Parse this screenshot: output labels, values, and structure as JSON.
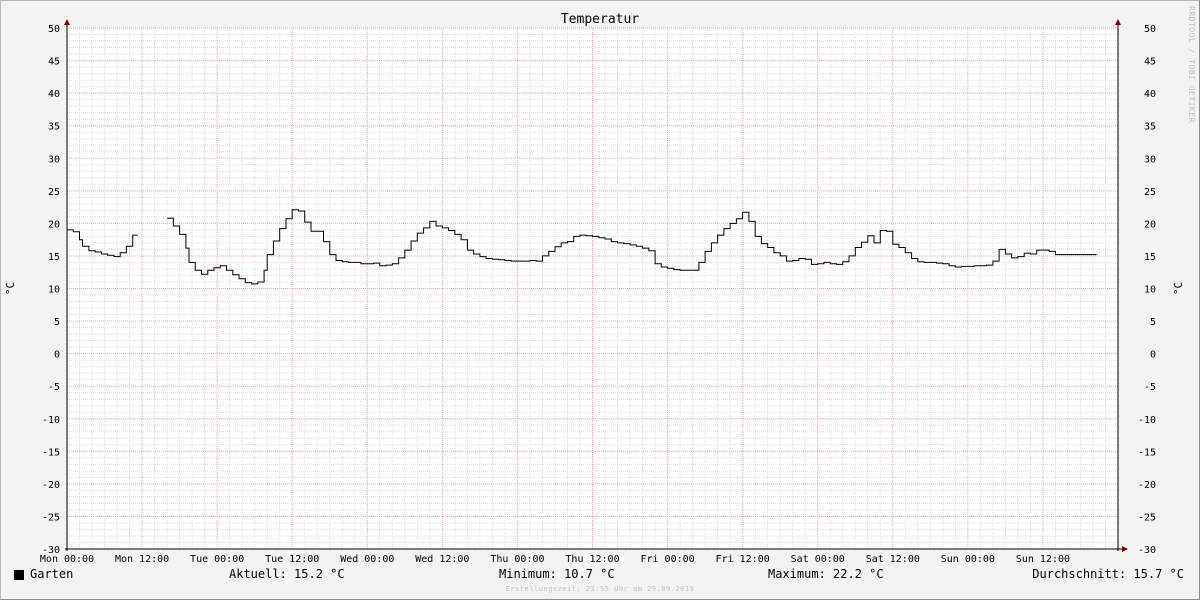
{
  "colors": {
    "background": "#f3f3f3",
    "canvas": "#ffffff",
    "minor_grid": "#dcdcdc",
    "major_grid": "#e8a6a6",
    "line": "#000000",
    "axis_arrow": "#7a0000"
  },
  "watermark": "RRDTOOL / TOBI OETIKER",
  "legend": {
    "series_name": "Garten",
    "current": "Aktuell: 15.2 °C",
    "minimum": "Minimum: 10.7 °C",
    "maximum": "Maximum: 22.2 °C",
    "average": "Durchschnitt: 15.7 °C"
  },
  "footer": "Erstellungszeit: 23:55 Uhr am 29.09.2019",
  "chart_data": {
    "type": "line",
    "title": "Temperatur",
    "ylabel": "°C",
    "ylabel_right": "°C",
    "ylim": [
      -30,
      50
    ],
    "xlim_hours": [
      0,
      168
    ],
    "y_ticks": [
      50,
      45,
      40,
      35,
      30,
      25,
      20,
      15,
      10,
      5,
      0,
      -5,
      -10,
      -15,
      -20,
      -25,
      -30
    ],
    "x_ticks": [
      {
        "hour": 0,
        "label": "Mon 00:00"
      },
      {
        "hour": 12,
        "label": "Mon 12:00"
      },
      {
        "hour": 24,
        "label": "Tue 00:00"
      },
      {
        "hour": 36,
        "label": "Tue 12:00"
      },
      {
        "hour": 48,
        "label": "Wed 00:00"
      },
      {
        "hour": 60,
        "label": "Wed 12:00"
      },
      {
        "hour": 72,
        "label": "Thu 00:00"
      },
      {
        "hour": 84,
        "label": "Thu 12:00"
      },
      {
        "hour": 96,
        "label": "Fri 00:00"
      },
      {
        "hour": 108,
        "label": "Fri 12:00"
      },
      {
        "hour": 120,
        "label": "Sat 00:00"
      },
      {
        "hour": 132,
        "label": "Sat 12:00"
      },
      {
        "hour": 144,
        "label": "Sun 00:00"
      },
      {
        "hour": 156,
        "label": "Sun 12:00"
      }
    ],
    "grid": true,
    "series": [
      {
        "name": "Garten",
        "step": true,
        "segments": [
          [
            [
              0,
              19
            ],
            [
              1,
              18.7
            ],
            [
              2,
              17.5
            ],
            [
              2.5,
              16.5
            ],
            [
              3.5,
              15.8
            ],
            [
              4.5,
              15.6
            ],
            [
              5.5,
              15.3
            ],
            [
              6.5,
              15.1
            ],
            [
              7.5,
              14.9
            ],
            [
              8.5,
              15.5
            ],
            [
              9.5,
              16.5
            ],
            [
              10.5,
              18.2
            ]
          ],
          [
            [
              16,
              20.8
            ],
            [
              17,
              19.6
            ],
            [
              18,
              18.3
            ],
            [
              19,
              16.2
            ],
            [
              19.5,
              14
            ],
            [
              20.5,
              12.8
            ],
            [
              21.5,
              12.2
            ],
            [
              22.5,
              12.8
            ],
            [
              23.5,
              13.2
            ],
            [
              24.5,
              13.5
            ],
            [
              25.5,
              12.8
            ],
            [
              26.5,
              12.1
            ],
            [
              27.5,
              11.5
            ],
            [
              28.5,
              10.9
            ],
            [
              29.5,
              10.7
            ],
            [
              30.5,
              11
            ],
            [
              31.5,
              12.8
            ],
            [
              32,
              15.2
            ],
            [
              33,
              17.3
            ],
            [
              34,
              19.2
            ],
            [
              35,
              20.7
            ],
            [
              36,
              22.1
            ],
            [
              37,
              21.9
            ],
            [
              38,
              20.2
            ],
            [
              39,
              18.8
            ],
            [
              40,
              18.8
            ],
            [
              41,
              17.2
            ],
            [
              42,
              15.2
            ],
            [
              43,
              14.3
            ],
            [
              44,
              14.1
            ],
            [
              45,
              14
            ],
            [
              46,
              14
            ],
            [
              47,
              13.8
            ],
            [
              48,
              13.8
            ],
            [
              49,
              13.9
            ],
            [
              50,
              13.5
            ],
            [
              51,
              13.6
            ],
            [
              52,
              13.8
            ],
            [
              53,
              14.7
            ],
            [
              54,
              15.9
            ],
            [
              55,
              17.3
            ],
            [
              56,
              18.5
            ],
            [
              57,
              19.3
            ],
            [
              58,
              20.3
            ],
            [
              59,
              19.6
            ],
            [
              60,
              19.3
            ],
            [
              61,
              18.9
            ],
            [
              62,
              18.3
            ],
            [
              63,
              17.5
            ],
            [
              64,
              15.9
            ],
            [
              65,
              15.3
            ],
            [
              66,
              14.9
            ],
            [
              67,
              14.6
            ],
            [
              68,
              14.5
            ],
            [
              69,
              14.4
            ],
            [
              70,
              14.3
            ],
            [
              71,
              14.2
            ],
            [
              72,
              14.2
            ],
            [
              73,
              14.2
            ],
            [
              74,
              14.3
            ],
            [
              75,
              14.2
            ],
            [
              76,
              15
            ],
            [
              77,
              15.7
            ],
            [
              78,
              16.4
            ],
            [
              79,
              17
            ],
            [
              80,
              17.2
            ],
            [
              81,
              18
            ],
            [
              82,
              18.2
            ],
            [
              83,
              18.1
            ],
            [
              84,
              18
            ],
            [
              85,
              17.8
            ],
            [
              86,
              17.6
            ],
            [
              87,
              17.2
            ],
            [
              88,
              17
            ],
            [
              89,
              16.9
            ],
            [
              90,
              16.7
            ],
            [
              91,
              16.5
            ],
            [
              92,
              16.2
            ],
            [
              93,
              15.8
            ],
            [
              94,
              13.8
            ],
            [
              95,
              13.3
            ],
            [
              96,
              13.1
            ],
            [
              97,
              12.9
            ],
            [
              98,
              12.8
            ],
            [
              99,
              12.8
            ],
            [
              100,
              12.8
            ],
            [
              101,
              14
            ],
            [
              102,
              15.7
            ],
            [
              103,
              17
            ],
            [
              104,
              18.2
            ],
            [
              105,
              19.2
            ],
            [
              106,
              20
            ],
            [
              107,
              20.7
            ],
            [
              108,
              21.7
            ],
            [
              109,
              20.3
            ],
            [
              110,
              18
            ],
            [
              111,
              16.9
            ],
            [
              112,
              16.3
            ],
            [
              113,
              15.5
            ],
            [
              114,
              15
            ],
            [
              115,
              14.2
            ],
            [
              116,
              14.3
            ],
            [
              117,
              14.6
            ],
            [
              118,
              14.5
            ],
            [
              119,
              13.7
            ],
            [
              120,
              13.8
            ],
            [
              121,
              14
            ],
            [
              122,
              13.8
            ],
            [
              123,
              13.7
            ],
            [
              124,
              14.1
            ],
            [
              125,
              15
            ],
            [
              126,
              16.3
            ],
            [
              127,
              17.1
            ],
            [
              128,
              18.1
            ],
            [
              129,
              17
            ],
            [
              130,
              18.9
            ],
            [
              131,
              18.8
            ],
            [
              132,
              16.8
            ],
            [
              133,
              16.3
            ],
            [
              134,
              15.5
            ],
            [
              135,
              14.6
            ],
            [
              136,
              14.1
            ],
            [
              137,
              14
            ],
            [
              138,
              14
            ],
            [
              139,
              13.9
            ],
            [
              140,
              13.8
            ],
            [
              141,
              13.5
            ],
            [
              142,
              13.3
            ],
            [
              143,
              13.4
            ],
            [
              144,
              13.4
            ],
            [
              145,
              13.5
            ],
            [
              146,
              13.5
            ],
            [
              147,
              13.6
            ],
            [
              148,
              14.2
            ],
            [
              149,
              16
            ],
            [
              150,
              15.3
            ],
            [
              151,
              14.7
            ],
            [
              152,
              14.9
            ],
            [
              153,
              15.4
            ],
            [
              154,
              15.3
            ],
            [
              155,
              15.9
            ],
            [
              156,
              15.9
            ],
            [
              157,
              15.7
            ],
            [
              158,
              15.2
            ],
            [
              159,
              15.2
            ],
            [
              160,
              15.2
            ],
            [
              161,
              15.2
            ],
            [
              162,
              15.2
            ],
            [
              163,
              15.2
            ],
            [
              163.8,
              15.2
            ]
          ]
        ]
      }
    ]
  }
}
